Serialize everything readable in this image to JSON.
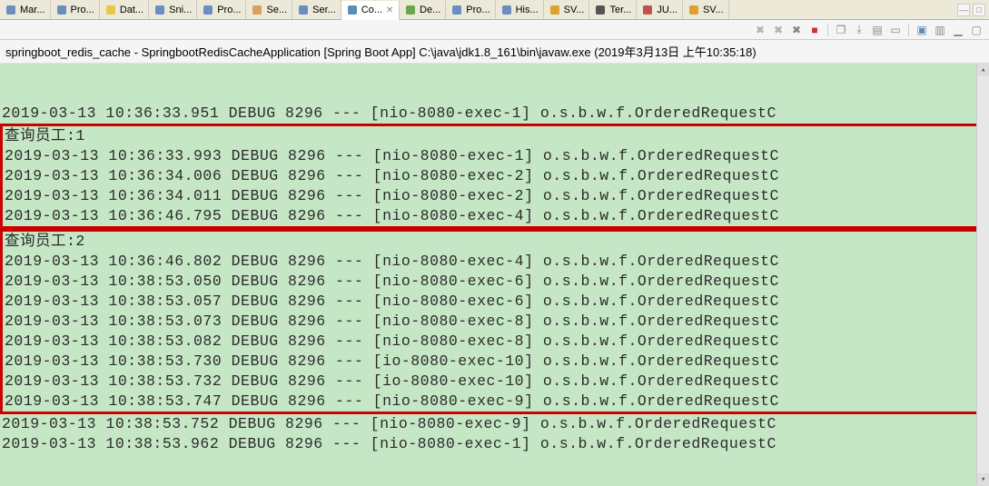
{
  "tabs": [
    {
      "label": "Mar...",
      "icon": "markers-icon",
      "color": "#6a8fbf"
    },
    {
      "label": "Pro...",
      "icon": "properties-icon",
      "color": "#6a8fbf"
    },
    {
      "label": "Dat...",
      "icon": "datasource-icon",
      "color": "#e7c94a"
    },
    {
      "label": "Sni...",
      "icon": "snippets-icon",
      "color": "#6a8fbf"
    },
    {
      "label": "Pro...",
      "icon": "problems-icon",
      "color": "#6a8fbf"
    },
    {
      "label": "Se...",
      "icon": "search-icon",
      "color": "#d8a060"
    },
    {
      "label": "Ser...",
      "icon": "servers-icon",
      "color": "#6a8fbf"
    },
    {
      "label": "Co...",
      "icon": "console-icon",
      "color": "#5a8eb5",
      "active": true,
      "closable": true
    },
    {
      "label": "De...",
      "icon": "debug-icon",
      "color": "#6aa84f"
    },
    {
      "label": "Pro...",
      "icon": "progress-icon",
      "color": "#6a8fbf"
    },
    {
      "label": "His...",
      "icon": "history-icon",
      "color": "#6a8fbf"
    },
    {
      "label": "SV...",
      "icon": "svn-icon",
      "color": "#e0a030"
    },
    {
      "label": "Ter...",
      "icon": "terminal-icon",
      "color": "#555"
    },
    {
      "label": "JU...",
      "icon": "junit-icon",
      "color": "#c0504d"
    },
    {
      "label": "SV...",
      "icon": "svn-icon",
      "color": "#e0a030"
    }
  ],
  "toolbar_icons": [
    {
      "name": "remove-launch-icon",
      "glyph": "✖",
      "color": "#b0b0b0"
    },
    {
      "name": "remove-all-icon",
      "glyph": "✖",
      "color": "#b0b0b0"
    },
    {
      "name": "clear-console-icon",
      "glyph": "✖",
      "color": "#888"
    },
    {
      "name": "terminate-icon",
      "glyph": "■",
      "color": "#cc3333"
    },
    {
      "name": "sep"
    },
    {
      "name": "pin-icon",
      "glyph": "❐",
      "color": "#888"
    },
    {
      "name": "scroll-lock-icon",
      "glyph": "⤓",
      "color": "#888"
    },
    {
      "name": "show-console-icon",
      "glyph": "▤",
      "color": "#888"
    },
    {
      "name": "display-selected-icon",
      "glyph": "▭",
      "color": "#888"
    },
    {
      "name": "sep"
    },
    {
      "name": "open-console-icon",
      "glyph": "▣",
      "color": "#5a8eb5"
    },
    {
      "name": "new-console-icon",
      "glyph": "▥",
      "color": "#888"
    },
    {
      "name": "minimize-icon",
      "glyph": "▁",
      "color": "#888"
    },
    {
      "name": "maximize-icon",
      "glyph": "▢",
      "color": "#888"
    }
  ],
  "launch_line": "springboot_redis_cache - SpringbootRedisCacheApplication [Spring Boot App] C:\\java\\jdk1.8_161\\bin\\javaw.exe (2019年3月13日 上午10:35:18)",
  "console": {
    "pre_lines": [
      "2019-03-13 10:36:33.951 DEBUG 8296 --- [nio-8080-exec-1] o.s.b.w.f.OrderedRequestC"
    ],
    "box1": {
      "header": "查询员工:1",
      "lines": [
        "2019-03-13 10:36:33.993 DEBUG 8296 --- [nio-8080-exec-1] o.s.b.w.f.OrderedRequestC",
        "2019-03-13 10:36:34.006 DEBUG 8296 --- [nio-8080-exec-2] o.s.b.w.f.OrderedRequestC",
        "2019-03-13 10:36:34.011 DEBUG 8296 --- [nio-8080-exec-2] o.s.b.w.f.OrderedRequestC",
        "2019-03-13 10:36:46.795 DEBUG 8296 --- [nio-8080-exec-4] o.s.b.w.f.OrderedRequestC"
      ]
    },
    "box2": {
      "header": "查询员工:2",
      "lines": [
        "2019-03-13 10:36:46.802 DEBUG 8296 --- [nio-8080-exec-4] o.s.b.w.f.OrderedRequestC",
        "2019-03-13 10:38:53.050 DEBUG 8296 --- [nio-8080-exec-6] o.s.b.w.f.OrderedRequestC",
        "2019-03-13 10:38:53.057 DEBUG 8296 --- [nio-8080-exec-6] o.s.b.w.f.OrderedRequestC",
        "2019-03-13 10:38:53.073 DEBUG 8296 --- [nio-8080-exec-8] o.s.b.w.f.OrderedRequestC",
        "2019-03-13 10:38:53.082 DEBUG 8296 --- [nio-8080-exec-8] o.s.b.w.f.OrderedRequestC",
        "2019-03-13 10:38:53.730 DEBUG 8296 --- [io-8080-exec-10] o.s.b.w.f.OrderedRequestC",
        "2019-03-13 10:38:53.732 DEBUG 8296 --- [io-8080-exec-10] o.s.b.w.f.OrderedRequestC",
        "2019-03-13 10:38:53.747 DEBUG 8296 --- [nio-8080-exec-9] o.s.b.w.f.OrderedRequestC"
      ]
    },
    "post_lines": [
      "2019-03-13 10:38:53.752 DEBUG 8296 --- [nio-8080-exec-9] o.s.b.w.f.OrderedRequestC",
      "2019-03-13 10:38:53.962 DEBUG 8296 --- [nio-8080-exec-1] o.s.b.w.f.OrderedRequestC"
    ]
  }
}
